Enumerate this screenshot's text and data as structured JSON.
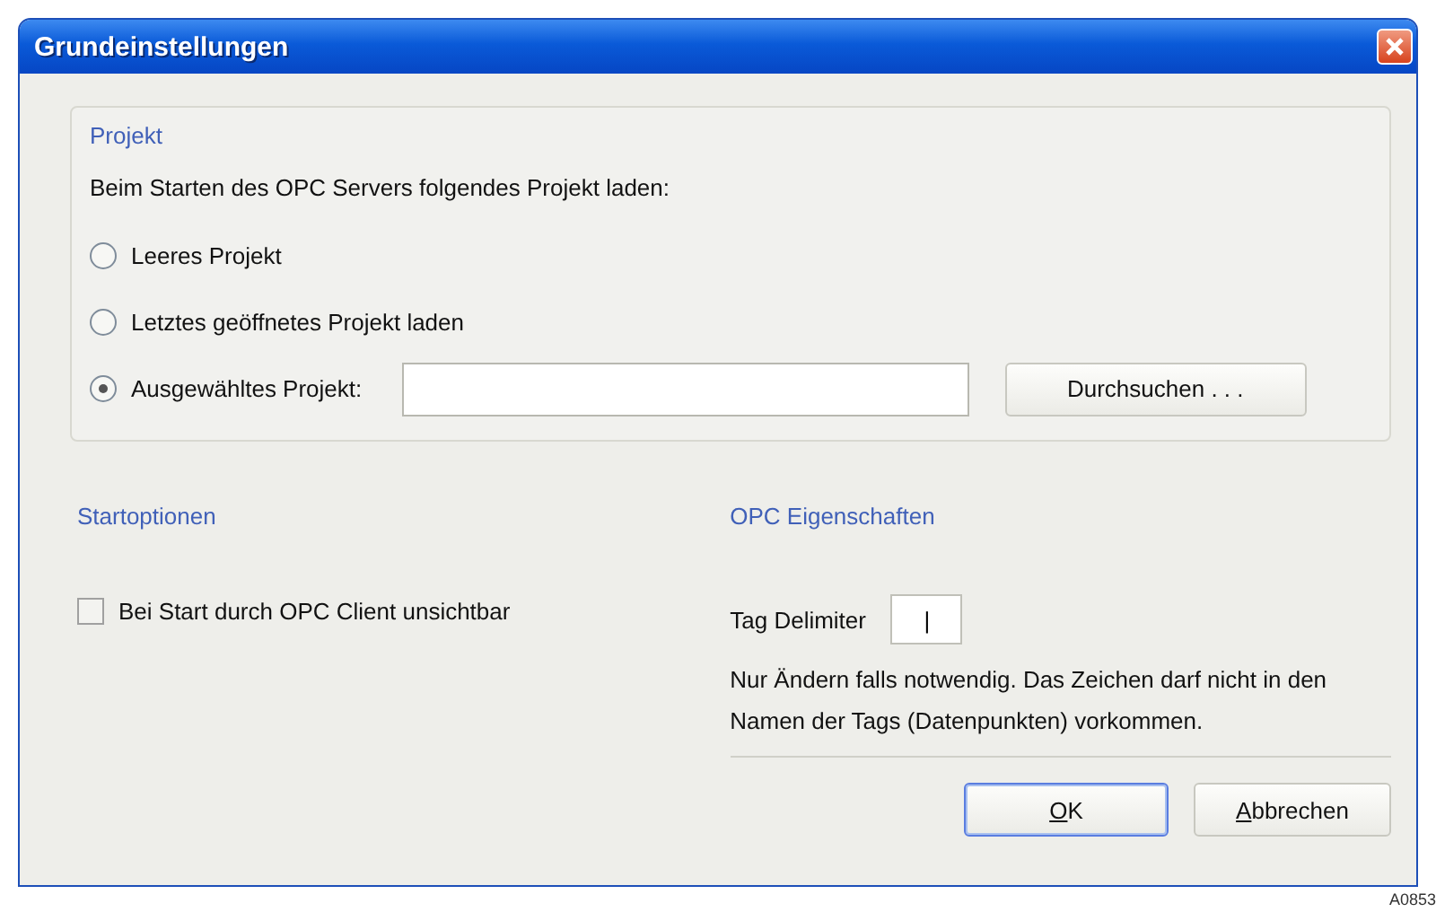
{
  "window": {
    "title": "Grundeinstellungen"
  },
  "projekt": {
    "title": "Projekt",
    "prompt": "Beim Starten des OPC Servers folgendes Projekt laden:",
    "options": [
      {
        "label": "Leeres Projekt",
        "selected": false
      },
      {
        "label": "Letztes geöffnetes Projekt laden",
        "selected": false
      },
      {
        "label": "Ausgewähltes Projekt:",
        "selected": true,
        "has_path": true
      }
    ],
    "browse_button": "Durchsuchen . . ."
  },
  "startoptionen": {
    "title": "Startoptionen",
    "checkbox": {
      "label": "Bei Start durch OPC Client unsichtbar",
      "checked": false
    }
  },
  "opc": {
    "title": "OPC Eigenschaften",
    "delimiter_label": "Tag Delimiter",
    "delimiter_value": "|",
    "note": "Nur Ändern falls notwendig. Das Zeichen darf nicht in den Namen der Tags (Datenpunkten) vorkommen."
  },
  "buttons": [
    {
      "label": "OK",
      "first_letter_underlined": true,
      "default": true
    },
    {
      "label": "Abbrechen",
      "first_letter_underlined": true,
      "default": false
    }
  ],
  "figure_label": "A0853"
}
